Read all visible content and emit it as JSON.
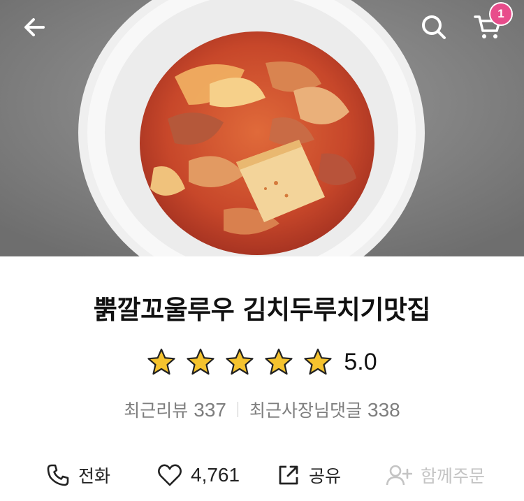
{
  "header": {
    "back_icon": "arrow-left-icon",
    "search_icon": "search-icon",
    "cart_icon": "cart-icon",
    "cart_count": "1",
    "badge_color": "#e84c8b"
  },
  "hero": {
    "image": "kimchi-duruchigi-dish-photo"
  },
  "store": {
    "name": "뿕깔꼬울루우 김치두루치기맛집",
    "star_icon": "star-icon",
    "stars_filled": 5,
    "stars_total": 5,
    "rating": "5.0",
    "star_color": "#f5b82e"
  },
  "stats": {
    "recent_reviews_label": "최근리뷰",
    "recent_reviews_count": "337",
    "owner_replies_label": "최근사장님댓글",
    "owner_replies_count": "338"
  },
  "actions": {
    "call_label": "전화",
    "call_icon": "phone-icon",
    "like_count": "4,761",
    "like_icon": "heart-icon",
    "share_label": "공유",
    "share_icon": "share-icon",
    "group_order_label": "함께주문",
    "group_order_icon": "add-user-icon"
  }
}
